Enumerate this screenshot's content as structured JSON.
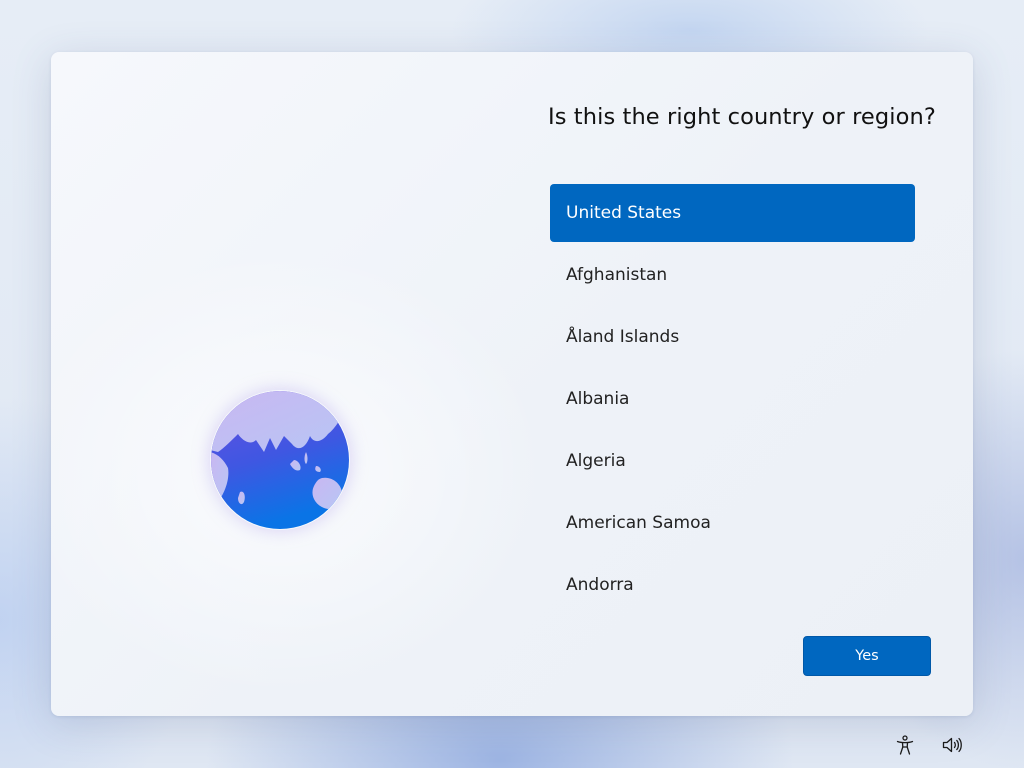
{
  "page": {
    "title": "Is this the right country or region?"
  },
  "countries": [
    {
      "label": "United States",
      "selected": true
    },
    {
      "label": "Afghanistan",
      "selected": false
    },
    {
      "label": "Åland Islands",
      "selected": false
    },
    {
      "label": "Albania",
      "selected": false
    },
    {
      "label": "Algeria",
      "selected": false
    },
    {
      "label": "American Samoa",
      "selected": false
    },
    {
      "label": "Andorra",
      "selected": false
    }
  ],
  "actions": {
    "yes_label": "Yes"
  },
  "icons": {
    "illustration": "globe-icon",
    "accessibility": "accessibility-icon",
    "volume": "volume-icon"
  },
  "colors": {
    "accent": "#0067c0",
    "selected_text": "#ffffff",
    "text": "#222222"
  }
}
